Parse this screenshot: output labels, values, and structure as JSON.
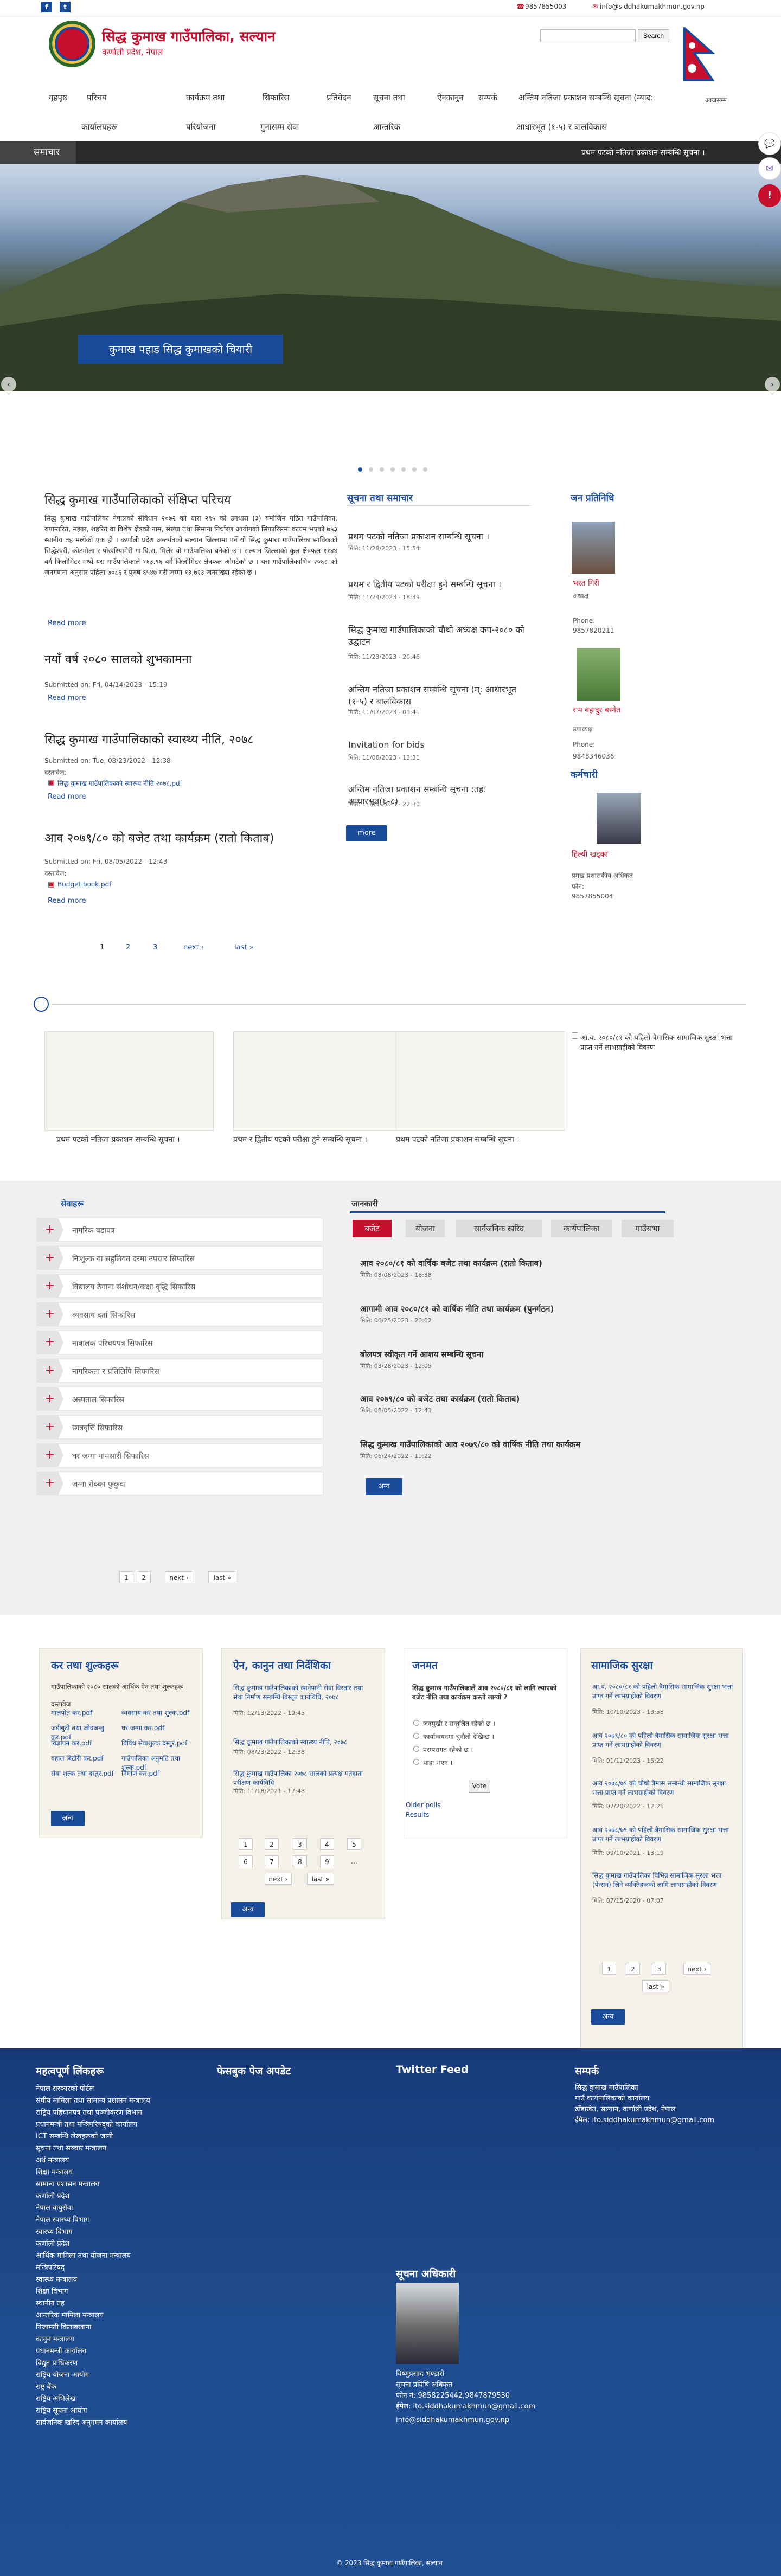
{
  "topbar": {
    "facebook_icon": "facebook-icon",
    "twitter_icon": "twitter-icon",
    "phone": "9857855003",
    "email": "info@siddhakumakhmun.gov.np"
  },
  "header": {
    "title": "सिद्ध कुमाख गाउँपालिका, सल्यान",
    "subtitle": "कर्णाली प्रदेश, नेपाल",
    "search_placeholder": "",
    "search_button": "Search",
    "flag_label": "आजसम्म"
  },
  "nav": {
    "row1": [
      "गृहपृष्ठ",
      "परिचय",
      "कार्यक्रम तथा",
      "सिफारिस",
      "प्रतिवेदन",
      "सूचना तथा",
      "ऐनकानुन",
      "सम्पर्क",
      "अन्तिम नतिजा प्रकाशन सम्बन्धि सूचना (म्याद:"
    ],
    "row2": [
      "कार्यालयहरू",
      "परियोजना",
      "गुनासम्म सेवा",
      "आन्तरिक",
      "आधारभूत (१-५) र बालविकास"
    ]
  },
  "ticker": {
    "label": "समाचार",
    "text": "प्रथम पटको नतिजा प्रकाशन सम्बन्धि सूचना ।"
  },
  "hero": {
    "caption": "कुमाख पहाड सिद्ध कुमाखको चियारी",
    "prev": "‹",
    "next": "›"
  },
  "intro": {
    "title": "सिद्ध कुमाख गाउँपालिकाको संक्षिप्त परिचय",
    "body": "सिद्ध कुमाख गाउँपालिका नेपालको संविधान २०७२ को धारा २९५ को उपधारा (३) बमोजिम गठित गाउँपालिका, रुपान्तरित, मझार, शहरित वा विशेष क्षेत्रको नाम, संख्या तथा सिमाना निर्धारण आयोगको सिफारिसमा कायम भएको ७५३ स्थानीय तह मध्येको एक हो । कर्णाली प्रदेश अन्तर्गतको सल्यान जिल्लामा पर्ने यो सिद्ध कुमाख गाउँपालिका साविकको सिद्धेश्वरी, कोटमौला र पोखरियामेरी गा.वि.स. मिलेर यो गाउँपालिका बनेको छ । सल्यान जिल्लाको कुल क्षेत्रफल ११४४ वर्ग किलोमिटर मध्ये यस गाउँपालिकाले १६३.९६ वर्ग किलोमिटर क्षेत्रफल ओगटेको छ । यस गाउँपालिकाभित्र २०६८ को जनगणना अनुसार पहिला ७०८६ र पुरुष ६५४७ गरी जम्मा १३,७२३ जनसंख्या रहेको छ ।",
    "read_more": "Read more"
  },
  "articles": [
    {
      "title": "नयाँ वर्ष २०८० सालको शुभकामना",
      "meta": "Submitted on: Fri, 04/14/2023 - 15:19",
      "attach_label": "",
      "attach": "",
      "read_more": "Read more"
    },
    {
      "title": "सिद्ध कुमाख गाउँपालिकाको स्वास्थ्य नीति, २०७८",
      "meta": "Submitted on: Tue, 08/23/2022 - 12:38",
      "attach_label": "दस्तावेज:",
      "attach": "सिद्ध कुमाख गाउँपालिकाको स्वास्थ्य नीति २०७८.pdf",
      "read_more": "Read more"
    },
    {
      "title": "आव २०७९/८० को बजेट तथा कार्यक्रम (रातो किताब)",
      "meta": "Submitted on: Fri, 08/05/2022 - 12:43",
      "attach_label": "दस्तावेज:",
      "attach": "Budget book.pdf",
      "read_more": "Read more"
    }
  ],
  "main_pager": [
    "1",
    "2",
    "3",
    "next ›",
    "last »"
  ],
  "news": {
    "title": "सूचना तथा समाचार",
    "items": [
      {
        "title": "प्रथम पटको नतिजा प्रकाशन सम्बन्धि सूचना ।",
        "date": "मिति: 11/28/2023 - 15:54"
      },
      {
        "title": "प्रथम र द्वितीय पटको परीक्षा हुने सम्बन्धि सूचना ।",
        "date": "मिति: 11/24/2023 - 18:39"
      },
      {
        "title": "सिद्ध कुमाख गाउँपालिकाको चौथो अध्यक्ष कप-२०८० को उद्घाटन",
        "date": "मिति: 11/23/2023 - 20:46"
      },
      {
        "title": "अन्तिम नतिजा प्रकाशन सम्बन्धि सूचना (म्: आधारभूत (१-५) र बालविकास",
        "date": "मिति: 11/07/2023 - 09:41"
      },
      {
        "title": "Invitation for bids",
        "date": "मिति: 11/06/2023 - 13:31"
      },
      {
        "title": "अन्तिम नतिजा प्रकाशन सम्बन्धि सूचना :तह: आधारभूत(६-८)",
        "date": "मिति: 11/05/2023 - 22:30"
      }
    ],
    "more": "more"
  },
  "representatives": {
    "title": "जन प्रतिनिधि",
    "people": [
      {
        "name": "भरत गिरी",
        "role": "अध्यक्ष",
        "phone_label": "Phone:",
        "phone": "9857820211"
      },
      {
        "name": "राम बहादुर बस्नेत",
        "role": "उपाध्यक्ष",
        "phone_label": "Phone:",
        "phone": "9848346036"
      }
    ],
    "staff_title": "कर्मचारी",
    "staff": {
      "name": "हिल्यी खड्का",
      "role": "प्रमुख प्रशासकीय अधिकृत",
      "phone_label": "फोन:",
      "phone": "9857855004"
    }
  },
  "gallery": [
    {
      "caption": "प्रथम पटको नतिजा प्रकाशन सम्बन्धि सूचना ।"
    },
    {
      "caption": "प्रथम र द्वितीय पटको परीक्षा हुने सम्बन्धि सूचना ।"
    },
    {
      "caption": "प्रथम पटको नतिजा प्रकाशन सम्बन्धि सूचना ।"
    },
    {
      "caption": "आ.व. २०८०/८१ को पहिलो त्रैमासिक सामाजिक सुरक्षा भत्ता प्राप्त गर्ने लाभग्राहीको विवरण"
    }
  ],
  "services": {
    "title": "सेवाहरू",
    "items": [
      "नागरिक बडापत्र",
      "निःशुल्क वा सहुलियत दरमा उपचार सिफारिस",
      "विद्यालय ठेगाना संशोधन/कक्षा वृद्धि सिफारिस",
      "व्यवसाय दर्ता सिफारिस",
      "नाबालक परिचयपत्र सिफारिस",
      "नागरिकता र प्रतिलिपि सिफारिस",
      "अस्पताल सिफारिस",
      "छात्रवृत्ति सिफारिस",
      "घर जग्गा नामसारी सिफारिस",
      "जग्गा रोक्का फुकुवा"
    ],
    "pager": [
      "1",
      "2",
      "next ›",
      "last »"
    ]
  },
  "info": {
    "title": "जानकारी",
    "tabs": [
      "बजेट",
      "योजना",
      "सार्वजनिक खरिद",
      "कार्यपालिका",
      "गाउँसभा"
    ],
    "items": [
      {
        "title": "आव २०८०/८१ को वार्षिक बजेट तथा कार्यक्रम (रातो किताब)",
        "date": "मिति: 08/08/2023 - 16:38"
      },
      {
        "title": "आगामी आव २०८०/८१ को वार्षिक नीति तथा कार्यक्रम (पुनर्गठन)",
        "date": "मिति: 06/25/2023 - 20:02"
      },
      {
        "title": "बोलपत्र स्वीकृत गर्ने आशय सम्बन्धि सूचना",
        "date": "मिति: 03/28/2023 - 12:05"
      },
      {
        "title": "आव २०७९/८० को बजेट तथा कार्यक्रम (रातो किताब)",
        "date": "मिति: 08/05/2022 - 12:43"
      },
      {
        "title": "सिद्ध कुमाख गाउँपालिकाको आव २०७९/८० को वार्षिक नीति तथा कार्यक्रम",
        "date": "मिति: 06/24/2022 - 19:22"
      }
    ],
    "more": "अन्य"
  },
  "cards": {
    "tax": {
      "title": "कर तथा शुल्कहरू",
      "body": "गाउँपालिकाको २०८० सालको आर्थिक ऐन तथा शुल्कहरू",
      "attach_label": "दस्तावेज",
      "files": [
        "मालपोत कर.pdf",
        "व्यवसाय कर तथा शुल्क.pdf",
        "जडीबुटी तथा जीवजन्तु कर.pdf",
        "घर जग्गा कर.pdf",
        "विज्ञापन कर.pdf",
        "विविध सेवाशुल्क दस्तुर.pdf",
        "बहाल बिटौरी कर.pdf",
        "गाउँपालिका अनुमति तथा शुल्क.pdf",
        "सेवा शुल्क तथा दस्तुर.pdf",
        "निर्माण कर.pdf"
      ],
      "more": "अन्य"
    },
    "law": {
      "title": "ऐन, कानुन तथा निर्देशिका",
      "items": [
        {
          "title": "सिद्ध कुमाख गाउँपालिकाको खानेपानी सेवा विस्तार तथा सेवा निर्माण सम्बन्धि विस्तृत कार्यविधि, २०७८",
          "date": "मिति: 12/13/2022 - 19:45"
        },
        {
          "title": "सिद्ध कुमाख गाउँपालिकाको स्वास्थ्य नीति, २०७८",
          "date": "मिति: 08/23/2022 - 12:38"
        },
        {
          "title": "सिद्ध कुमाख गाउँपालिका २०७८ सालको प्रत्यक्ष मतदाता परीक्षण कार्यविधि",
          "date": "मिति: 11/18/2021 - 17:48"
        }
      ],
      "pager": [
        "1",
        "2",
        "3",
        "4",
        "5",
        "6",
        "7",
        "8",
        "9",
        "…",
        "next ›",
        "last »"
      ],
      "more": "अन्य"
    },
    "poll": {
      "title": "जनमत",
      "question": "सिद्ध कुमाख गाउँपालिकाले आव २०८०/८१ को लागि ल्याएको बजेट नीति तथा कार्यक्रम कस्तो लाग्यो ?",
      "options": [
        "जनमुखी र सन्तुलित रहेको छ ।",
        "कार्यान्वयनमा चुनौती देखिन्छ ।",
        "परम्परागत रहेको छ ।",
        "थाहा भएन ।"
      ],
      "vote": "Vote",
      "older": "Older polls",
      "results": "Results"
    },
    "social": {
      "title": "सामाजिक सुरक्षा",
      "items": [
        {
          "title": "आ.व. २०८०/८१ को पहिलो त्रैमासिक सामाजिक सुरक्षा भत्ता प्राप्त गर्ने लाभग्राहीको विवरण",
          "date": "मिति: 10/10/2023 - 13:58"
        },
        {
          "title": "आव २०७९/८० को पहिलो त्रैमासिक सामाजिक सुरक्षा भत्ता प्राप्त गर्ने लाभग्राहीको विवरण",
          "date": "मिति: 01/11/2023 - 15:22"
        },
        {
          "title": "आव २०७८/७९ को चौथो त्रैमास सम्बन्धी सामाजिक सुरक्षा भत्ता प्राप्त गर्ने लाभग्राहीको विवरण",
          "date": "मिति: 07/20/2022 - 12:26"
        },
        {
          "title": "आव २०७८/७९ को पहिलो त्रैमासिक सामाजिक सुरक्षा भत्ता प्राप्त गर्ने लाभग्राहीको विवरण",
          "date": "मिति: 09/10/2021 - 13:19"
        },
        {
          "title": "सिद्ध कुमाख गाउँपालिका विभिन्न सामाजिक सुरक्षा भत्ता (पेन्सन) लिने व्यक्तिहरूको लागि लाभग्राहीको विवरण",
          "date": "मिति: 07/15/2020 - 07:07"
        }
      ],
      "pager": [
        "1",
        "2",
        "3",
        "next ›",
        "last »"
      ],
      "more": "अन्य"
    }
  },
  "footer": {
    "links_title": "महत्वपूर्ण लिंकहरू",
    "links": [
      "नेपाल सरकारको पोर्टल",
      "संघीय मामिला तथा सामान्य प्रशासन मन्त्रालय",
      "राष्ट्रिय पहिचानपत्र तथा पञ्जीकरण विभाग",
      "प्रधानमन्त्री तथा मन्त्रिपरिषद्को कार्यालय",
      "ICT सम्बन्धि लेखहरूको जानी",
      "सूचना तथा सञ्चार मन्त्रालय",
      "अर्थ मन्त्रालय",
      "शिक्षा मन्त्रालय",
      "सामान्य प्रशासन मन्त्रालय",
      "कर्णाली प्रदेश",
      "नेपाल वायुसेवा",
      "नेपाल स्वास्थ्य विभाग",
      "स्वास्थ्य विभाग",
      "कर्णाली प्रदेश",
      "आर्थिक मामिला तथा योजना मन्त्रालय",
      "मन्त्रिपरिषद्",
      "स्वास्थ्य मन्त्रालय",
      "शिक्षा विभाग",
      "स्थानीय तह",
      "आन्तरिक मामिला मन्त्रालय",
      "निजामती किताबखाना",
      "कानुन मन्त्रालय",
      "प्रधानमन्त्री कार्यालय",
      "विद्युत प्राधिकरण",
      "राष्ट्रिय योजना आयोग",
      "राष्ट्र बैंक",
      "राष्ट्रिय अभिलेख",
      "राष्ट्रिय सूचना आयोग",
      "सार्वजनिक खरिद अनुगमन कार्यालय"
    ],
    "facebook_title": "फेसबुक पेज अपडेट",
    "twitter_title": "Twitter Feed",
    "contact_title": "सम्पर्क",
    "contact_lines": [
      "सिद्ध कुमाख गाउँपालिका",
      "गाउँ कार्यपालिकाको कार्यालय",
      "ढाँडाखेत, सल्यान, कर्णाली प्रदेश, नेपाल",
      "ईमेल: ito.siddhakumakhmun@gmail.com"
    ],
    "officer_title": "सूचना अधिकारी",
    "officer_lines": [
      "विष्णुप्रसाद भण्डारी",
      "सूचना प्रविधि अधिकृत",
      "फोन नं: 9858225442,9847879530",
      "ईमेल: ito.siddhakumakhmun@gmail.com",
      "info@siddhakumakhmun.gov.np"
    ],
    "copyright": "© 2023 सिद्ध कुमाख गाउँपालिका, सल्यान"
  },
  "side_icons": [
    "chat-icon",
    "messenger-icon",
    "alert-icon"
  ],
  "colors": {
    "primary": "#1a4a9a",
    "accent": "#c8102e",
    "footer": "#1f4d8f"
  }
}
